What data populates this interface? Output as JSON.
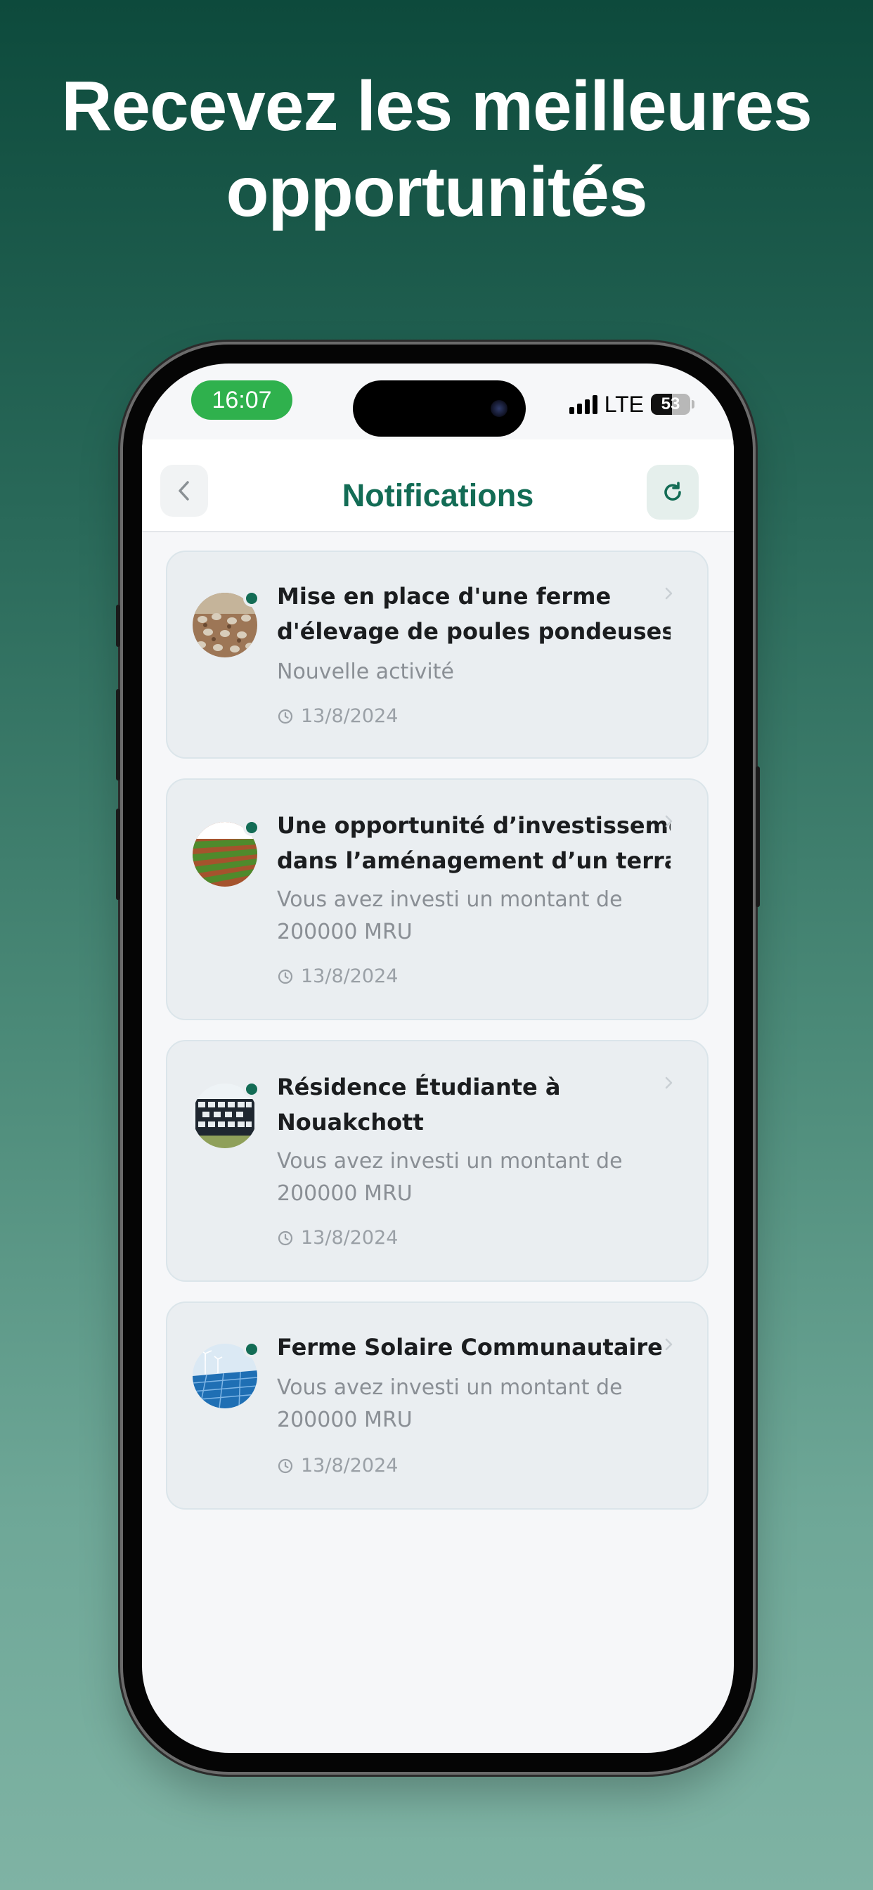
{
  "headline": {
    "line1": "Recevez les meilleures",
    "line2": "opportunités"
  },
  "status_bar": {
    "time": "16:07",
    "network": "LTE",
    "battery": "53",
    "battery_fraction": 0.53
  },
  "header": {
    "title": "Notifications",
    "back_icon": "chevron-left-icon",
    "refresh_icon": "refresh-icon"
  },
  "colors": {
    "accent": "#136c55",
    "status_green": "#2fb14d",
    "card_bg": "#eaeef1"
  },
  "notifications": [
    {
      "title_lines": [
        "Mise en place d'une ferme",
        "d'élevage de poules pondeuses(..."
      ],
      "subtitle_lines": [
        "Nouvelle activité"
      ],
      "date": "13/8/2024",
      "image": "poultry-farm-thumbnail"
    },
    {
      "title_lines": [
        "Une opportunité d’investissement",
        "dans l’aménagement d’un terrai..."
      ],
      "subtitle_lines": [
        "Vous avez investi un montant de",
        "200000 MRU"
      ],
      "date": "13/8/2024",
      "image": "farmland-thumbnail"
    },
    {
      "title_lines": [
        "Résidence Étudiante à",
        "Nouakchott"
      ],
      "subtitle_lines": [
        "Vous avez investi un montant de",
        "200000 MRU"
      ],
      "date": "13/8/2024",
      "image": "student-residence-thumbnail"
    },
    {
      "title_lines": [
        "Ferme Solaire Communautaire"
      ],
      "subtitle_lines": [
        "Vous avez investi un montant de",
        "200000 MRU"
      ],
      "date": "13/8/2024",
      "image": "solar-farm-thumbnail"
    }
  ]
}
